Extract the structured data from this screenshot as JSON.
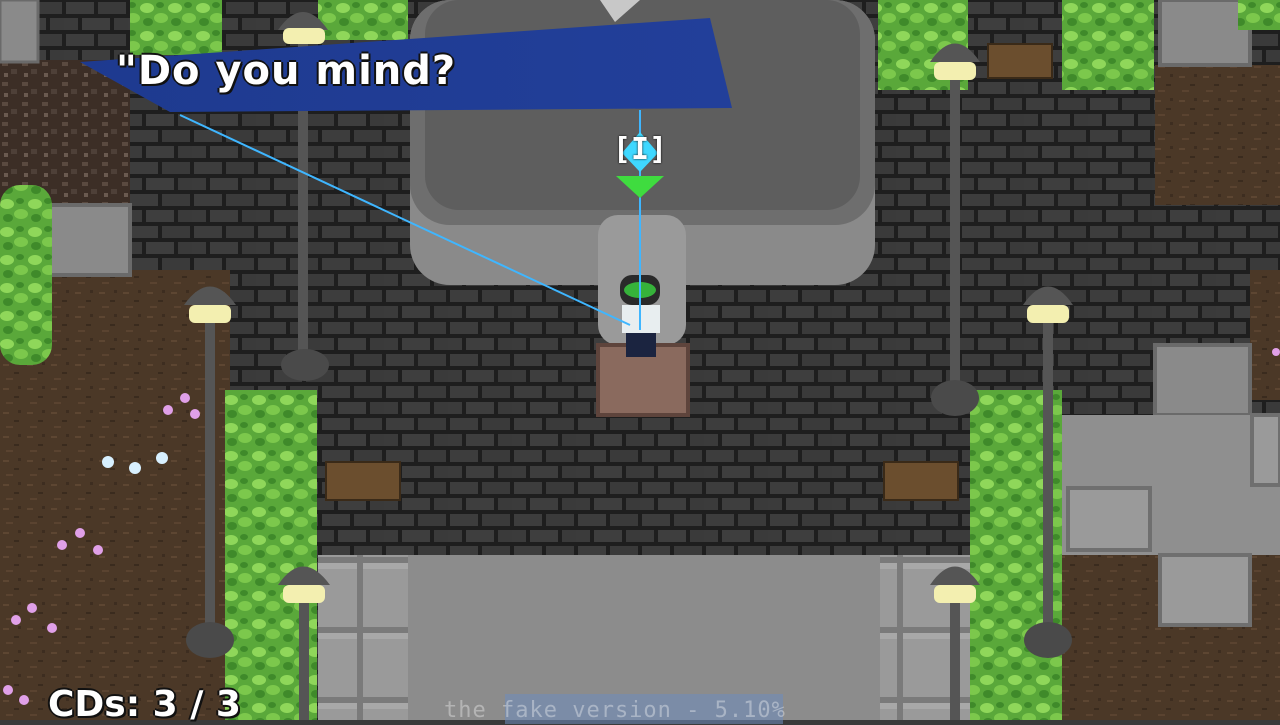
{
  "scene": {
    "name": "plaza-with-statue",
    "colors": {
      "brick": "#3b3b3b",
      "mortar": "#1f1f1f",
      "stone": "#8e8e8e",
      "soil": "#4e3a28",
      "hedge": "#6fbf3f",
      "dialogue_bg": "#1f3a8f",
      "target_line": "#3fb6ff"
    }
  },
  "dialogue": {
    "text": "\"Do you mind?"
  },
  "interaction_prompt": {
    "key_label": "[I]",
    "icon": "cyan-diamond-with-green-arrow-icon"
  },
  "hud": {
    "cds_label": "CDs: 3 / 3",
    "cds_current": 3,
    "cds_total": 3,
    "version_text": "the fake version - 5.10%"
  }
}
